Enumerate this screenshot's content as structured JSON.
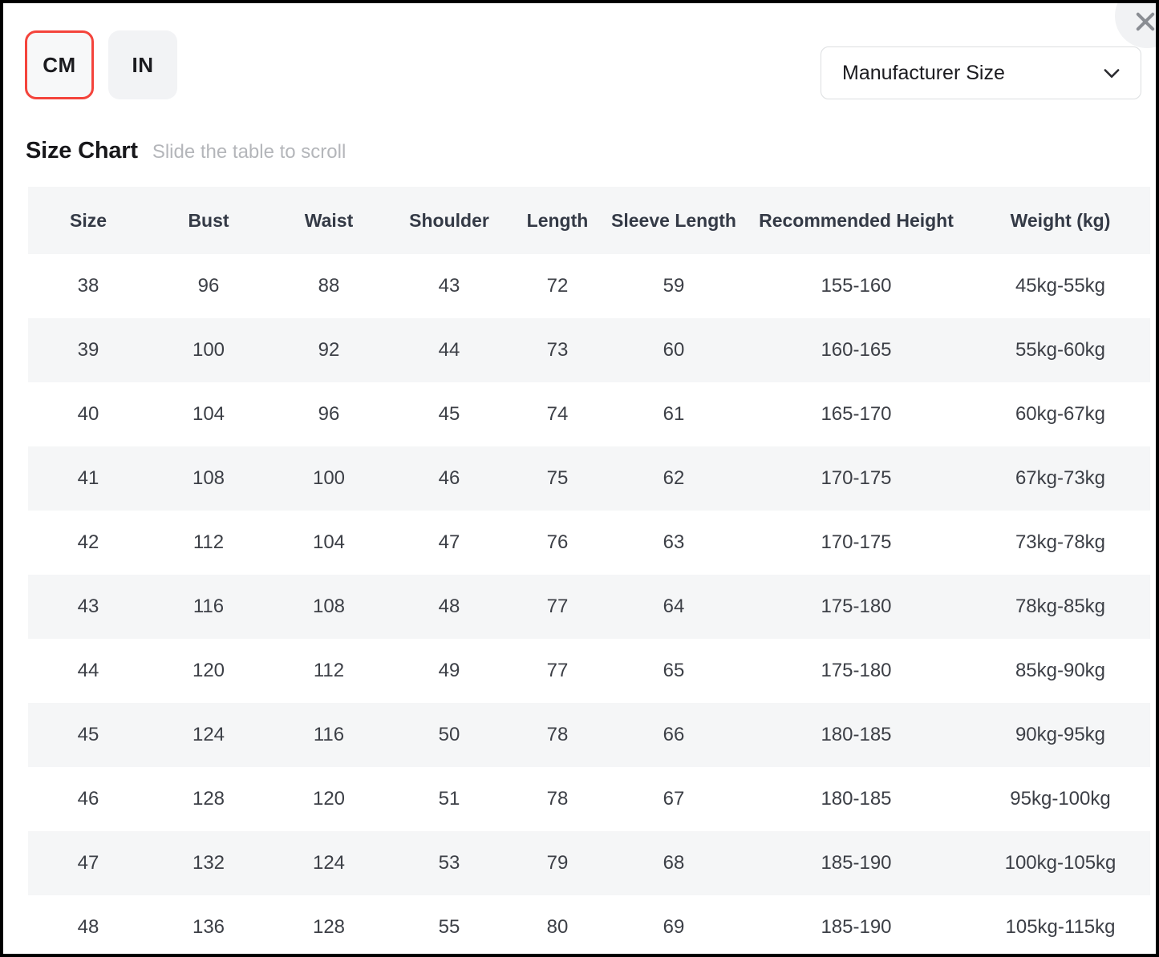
{
  "units": {
    "options": [
      {
        "label": "CM",
        "selected": true
      },
      {
        "label": "IN",
        "selected": false
      }
    ],
    "accent_color": "#f4443c"
  },
  "size_select": {
    "value": "Manufacturer Size",
    "icon": "chevron-down-icon"
  },
  "close": {
    "icon": "close-icon"
  },
  "title": "Size Chart",
  "hint": "Slide the table to scroll",
  "chart_data": {
    "type": "table",
    "title": "Size Chart",
    "unit_system": "CM",
    "columns": [
      "Size",
      "Bust",
      "Waist",
      "Shoulder",
      "Length",
      "Sleeve Length",
      "Recommended Height",
      "Weight (kg)"
    ],
    "rows": [
      [
        "38",
        "96",
        "88",
        "43",
        "72",
        "59",
        "155-160",
        "45kg-55kg"
      ],
      [
        "39",
        "100",
        "92",
        "44",
        "73",
        "60",
        "160-165",
        "55kg-60kg"
      ],
      [
        "40",
        "104",
        "96",
        "45",
        "74",
        "61",
        "165-170",
        "60kg-67kg"
      ],
      [
        "41",
        "108",
        "100",
        "46",
        "75",
        "62",
        "170-175",
        "67kg-73kg"
      ],
      [
        "42",
        "112",
        "104",
        "47",
        "76",
        "63",
        "170-175",
        "73kg-78kg"
      ],
      [
        "43",
        "116",
        "108",
        "48",
        "77",
        "64",
        "175-180",
        "78kg-85kg"
      ],
      [
        "44",
        "120",
        "112",
        "49",
        "77",
        "65",
        "175-180",
        "85kg-90kg"
      ],
      [
        "45",
        "124",
        "116",
        "50",
        "78",
        "66",
        "180-185",
        "90kg-95kg"
      ],
      [
        "46",
        "128",
        "120",
        "51",
        "78",
        "67",
        "180-185",
        "95kg-100kg"
      ],
      [
        "47",
        "132",
        "124",
        "53",
        "79",
        "68",
        "185-190",
        "100kg-105kg"
      ],
      [
        "48",
        "136",
        "128",
        "55",
        "80",
        "69",
        "185-190",
        "105kg-115kg"
      ]
    ]
  }
}
